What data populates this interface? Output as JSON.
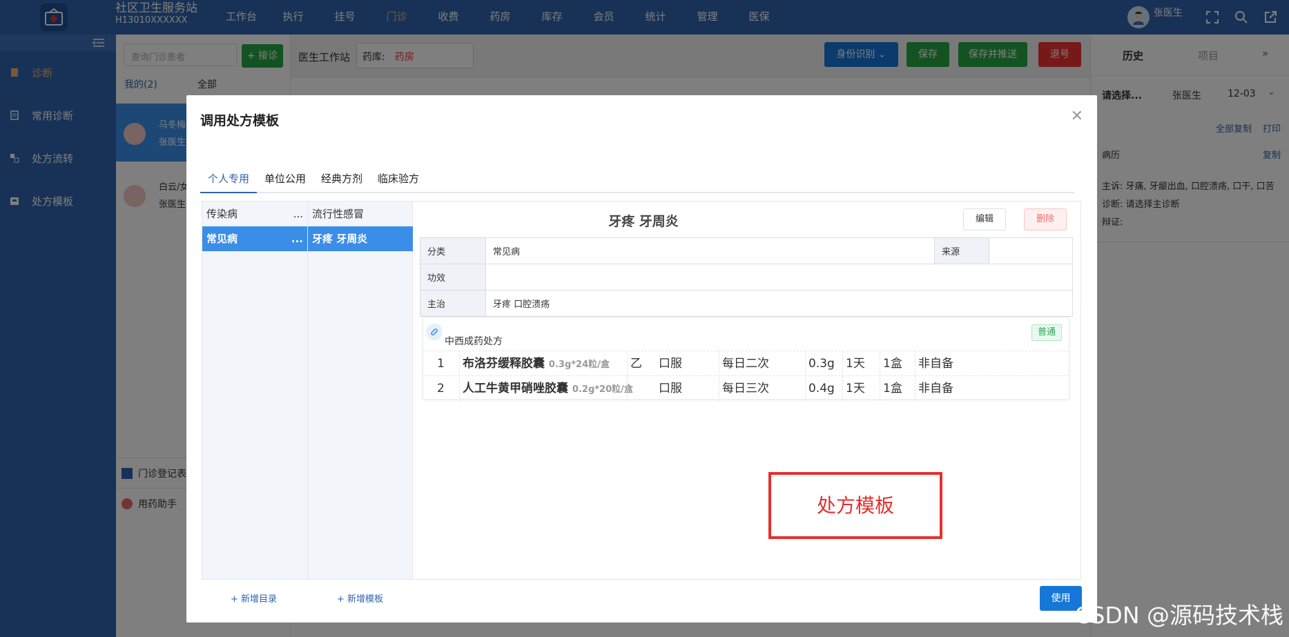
{
  "app": {
    "title": "社区卫生服务站",
    "code": "H13010XXXXXX",
    "nav": [
      "工作台",
      "执行",
      "挂号",
      "门诊",
      "收费",
      "药房",
      "库存",
      "会员",
      "统计",
      "管理",
      "医保"
    ],
    "nav_active_index": 3,
    "user": "张医生"
  },
  "sidebar": {
    "items": [
      {
        "label": "诊断",
        "icon": "document-icon"
      },
      {
        "label": "常用诊断",
        "icon": "clipboard-icon"
      },
      {
        "label": "处方流转",
        "icon": "share-icon"
      },
      {
        "label": "处方模板",
        "icon": "template-icon"
      }
    ]
  },
  "patients": {
    "search_placeholder": "查询门诊患者",
    "add_button": "+ 接诊",
    "tab_mine": "我的(2)",
    "tab_all": "全部",
    "cards": [
      {
        "name": "马冬梅",
        "doctor": "张医生"
      },
      {
        "name": "白云/女",
        "doctor": "张医生"
      }
    ],
    "lower_items": [
      "门诊登记表",
      "用药助手"
    ]
  },
  "workbar": {
    "title": "医生工作站",
    "pharmacy_label": "药库:",
    "pharmacy_value": "药房",
    "btn_id": "身份识别",
    "btn_save": "保存",
    "btn_save_push": "保存并推送",
    "btn_refund": "退号"
  },
  "right_panel": {
    "tab_history": "历史",
    "tab_items": "项目",
    "select_placeholder": "请选择...",
    "doctor": "张医生",
    "date": "12-03",
    "copy_all": "全部复制",
    "print": "打印",
    "record_label": "病历",
    "copy": "复制",
    "complaint": "主诉:  牙痛, 牙龈出血, 口腔溃疡, 口干, 口苦",
    "diagnosis": "诊断:   请选择主诊断",
    "syndrome": "辩证:"
  },
  "modal": {
    "title": "调用处方模板",
    "tabs": [
      "个人专用",
      "单位公用",
      "经典方剂",
      "临床验方"
    ],
    "active_tab": 0,
    "tree_col1": [
      {
        "label": "传染病",
        "more": "..."
      },
      {
        "label": "常见病",
        "more": "..."
      }
    ],
    "tree_col2": [
      "流行性感冒",
      "牙疼 牙周炎"
    ],
    "detail": {
      "title": "牙疼 牙周炎",
      "edit": "编辑",
      "delete": "删除",
      "category_label": "分类",
      "category_value": "常见病",
      "source_label": "来源",
      "source_value": "",
      "effect_label": "功效",
      "effect_value": "",
      "indication_label": "主治",
      "indication_value": "牙疼 口腔溃疡",
      "rx_name": "中西成药处方",
      "rx_tag": "普通",
      "drugs": [
        {
          "no": "1",
          "name": "布洛芬缓释胶囊",
          "spec": "0.3g*24粒/盒",
          "class": "乙",
          "route": "口服",
          "freq": "每日二次",
          "dose": "0.3g",
          "days": "1天",
          "qty": "1盒",
          "note": "非自备"
        },
        {
          "no": "2",
          "name": "人工牛黄甲硝唑胶囊",
          "spec": "0.2g*20粒/盒",
          "class": "",
          "route": "口服",
          "freq": "每日三次",
          "dose": "0.4g",
          "days": "1天",
          "qty": "1盒",
          "note": "非自备"
        }
      ]
    },
    "annotation": "处方模板",
    "add_dir": "+ 新增目录",
    "add_template": "+ 新增模板",
    "use_button": "使用"
  },
  "watermark": "CSDN @源码技术栈"
}
